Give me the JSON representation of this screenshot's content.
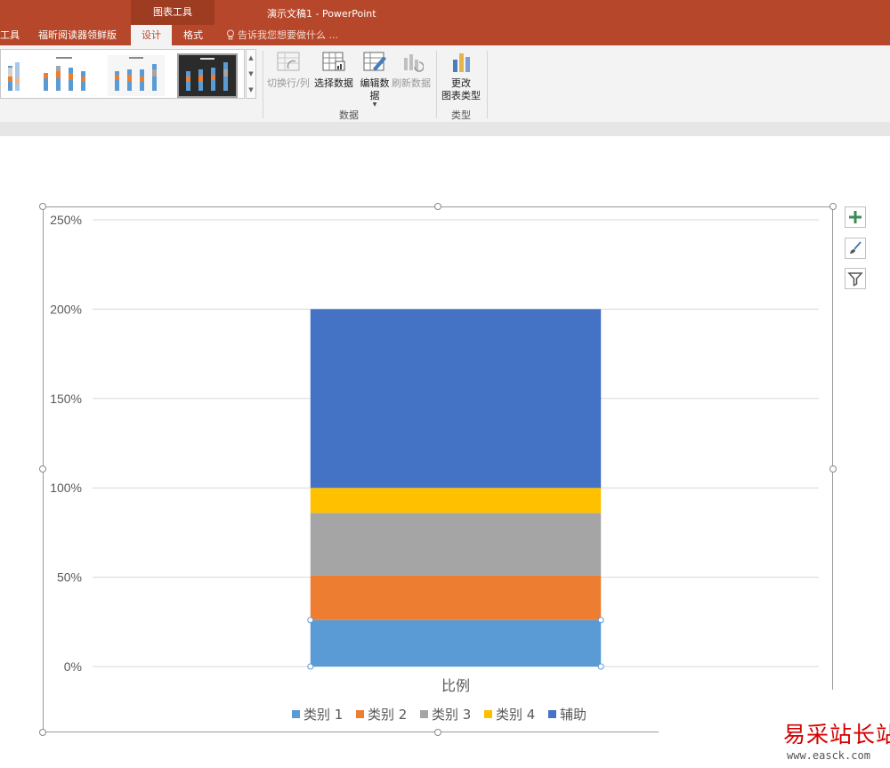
{
  "window": {
    "title": "演示文稿1 - PowerPoint",
    "context_group": "图表工具"
  },
  "tabs": [
    {
      "label": "工具"
    },
    {
      "label": "福昕阅读器领鲜版"
    },
    {
      "label": "设计",
      "active": true
    },
    {
      "label": "格式"
    }
  ],
  "tell_me": {
    "text": "告诉我您想要做什么 ..."
  },
  "ribbon": {
    "data_group": {
      "label": "数据",
      "buttons": [
        {
          "label": "切换行/列",
          "enabled": false,
          "icon": "switch-row-column-icon"
        },
        {
          "label": "选择数据",
          "enabled": true,
          "icon": "select-data-icon"
        },
        {
          "label": "编辑数据",
          "enabled": true,
          "icon": "edit-data-icon"
        },
        {
          "label": "刷新数据",
          "enabled": false,
          "icon": "refresh-data-icon"
        }
      ]
    },
    "type_group": {
      "label": "类型",
      "button": {
        "line1": "更改",
        "line2": "图表类型",
        "icon": "change-chart-type-icon"
      }
    }
  },
  "chart_data": {
    "type": "bar",
    "stacked": true,
    "categories": [
      "比例"
    ],
    "series": [
      {
        "name": "类别 1",
        "values": [
          0.26
        ],
        "color": "#5b9bd5"
      },
      {
        "name": "类别 2",
        "values": [
          0.25
        ],
        "color": "#ed7d31"
      },
      {
        "name": "类别 3",
        "values": [
          0.35
        ],
        "color": "#a5a5a5"
      },
      {
        "name": "类别 4",
        "values": [
          0.14
        ],
        "color": "#ffc000"
      },
      {
        "name": "辅助",
        "values": [
          1.0
        ],
        "color": "#4472c4"
      }
    ],
    "ylim": [
      0,
      2.5
    ],
    "yticks": [
      "0%",
      "50%",
      "100%",
      "150%",
      "200%",
      "250%"
    ],
    "ytick_values": [
      0,
      0.5,
      1.0,
      1.5,
      2.0,
      2.5
    ],
    "grid": true,
    "legend_position": "bottom",
    "xlabel": "",
    "ylabel": ""
  },
  "chart_tools": [
    {
      "icon": "plus-icon"
    },
    {
      "icon": "brush-icon"
    },
    {
      "icon": "filter-icon"
    }
  ],
  "watermark": {
    "logo_text": "易采站长站",
    "url": "www.easck.com"
  }
}
